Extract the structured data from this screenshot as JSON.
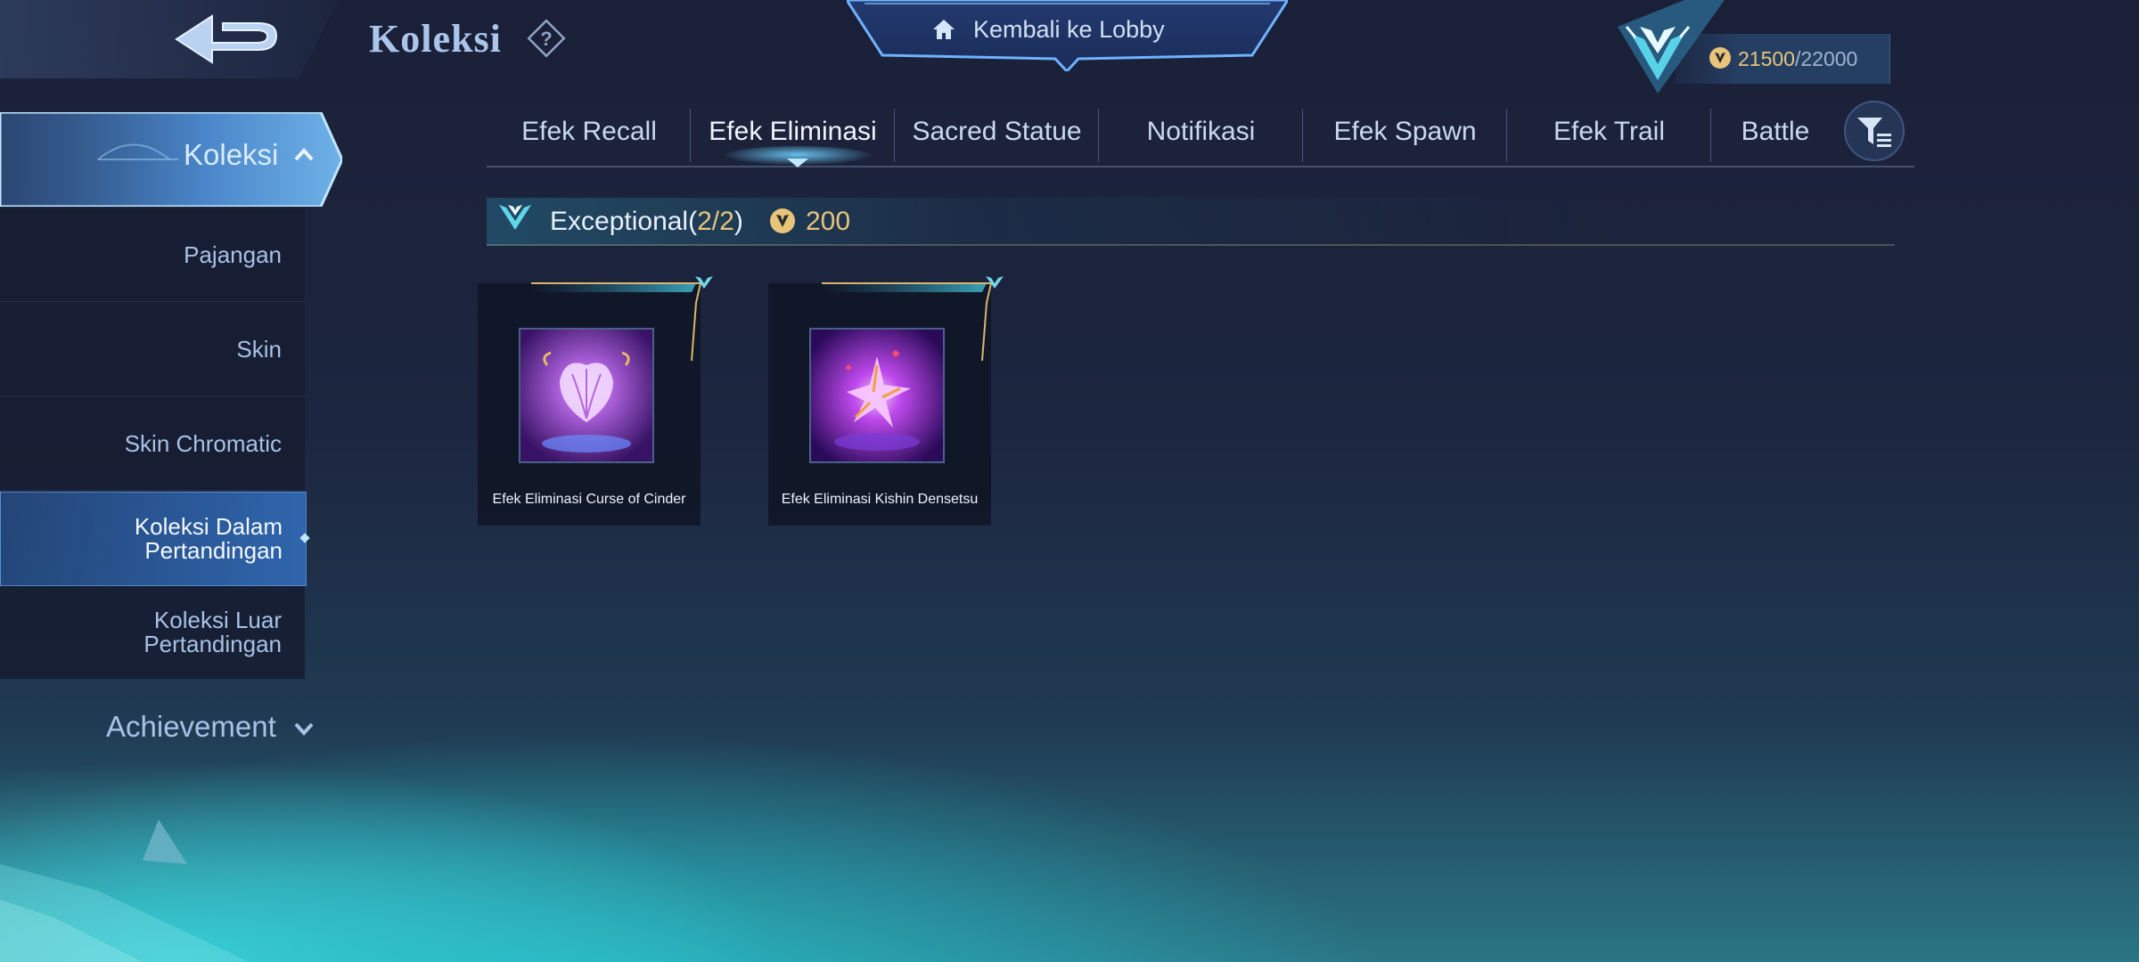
{
  "header": {
    "title": "Koleksi",
    "lobby_label": "Kembali ke Lobby",
    "points_current": "21500",
    "points_sep_max": "/22000"
  },
  "sidebar": {
    "expanded_label": "Koleksi",
    "items": [
      {
        "label": "Pajangan"
      },
      {
        "label": "Skin"
      },
      {
        "label": "Skin Chromatic"
      },
      {
        "label": "Koleksi Dalam\nPertandingan",
        "line1": "Koleksi Dalam",
        "line2": "Pertandingan"
      },
      {
        "label": "Koleksi Luar\nPertandingan",
        "line1": "Koleksi Luar",
        "line2": "Pertandingan"
      }
    ],
    "achievement_label": "Achievement"
  },
  "tabs": [
    {
      "label": "Efek Recall"
    },
    {
      "label": "Efek Eliminasi"
    },
    {
      "label": "Sacred Statue"
    },
    {
      "label": "Notifikasi"
    },
    {
      "label": "Efek Spawn"
    },
    {
      "label": "Efek Trail"
    },
    {
      "label": "Battle"
    }
  ],
  "section": {
    "name": "Exceptional",
    "count_open": "(",
    "count": "2/2",
    "count_close": ")",
    "points": "200"
  },
  "cards": [
    {
      "name": "Efek Eliminasi Curse of Cinder"
    },
    {
      "name": "Efek Eliminasi Kishin Densetsu"
    }
  ],
  "colors": {
    "accent_gold": "#e7c47a",
    "active_blue": "#3f79c4",
    "text_light": "#d7e6f5"
  },
  "icons": {
    "back": "back-arrow-icon",
    "help": "question-diamond-icon",
    "home": "home-icon",
    "filter": "filter-icon",
    "rank": "rank-emblem-icon",
    "coin": "collection-point-coin-icon"
  }
}
